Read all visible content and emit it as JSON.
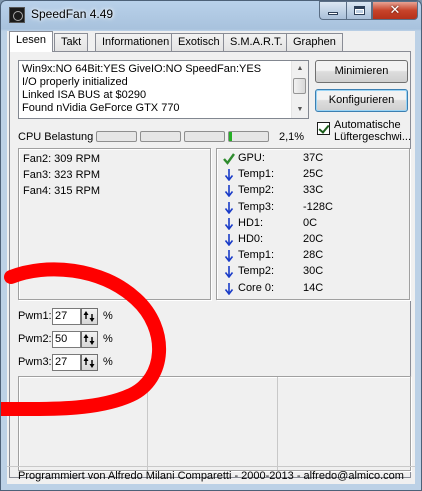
{
  "window": {
    "title": "SpeedFan 4.49",
    "close_glyph": "✕"
  },
  "tabs": [
    {
      "label": "Lesen",
      "active": true
    },
    {
      "label": "Takt"
    },
    {
      "label": "Informationen"
    },
    {
      "label": "Exotisch"
    },
    {
      "label": "S.M.A.R.T."
    },
    {
      "label": "Graphen"
    }
  ],
  "log": {
    "lines": [
      "Win9x:NO  64Bit:YES  GiveIO:NO  SpeedFan:YES",
      "I/O properly initialized",
      "Linked ISA BUS at $0290",
      "Found nVidia GeForce GTX 770"
    ]
  },
  "buttons": {
    "minimize": "Minimieren",
    "configure": "Konfigurieren"
  },
  "auto_fan": {
    "label": "Automatische Lüftergeschwi...",
    "checked": true
  },
  "cpu": {
    "label": "CPU Belastung",
    "value": "2,1%",
    "load_percent": 2.1
  },
  "fans": [
    {
      "text": "Fan2: 309 RPM"
    },
    {
      "text": "Fan3: 323 RPM"
    },
    {
      "text": "Fan4: 315 RPM"
    }
  ],
  "temps": [
    {
      "name": "GPU:",
      "value": "37C",
      "icon": "check-icon"
    },
    {
      "name": "Temp1:",
      "value": "25C",
      "icon": "arrow-down-icon"
    },
    {
      "name": "Temp2:",
      "value": "33C",
      "icon": "arrow-down-icon"
    },
    {
      "name": "Temp3:",
      "value": "-128C",
      "icon": "arrow-down-icon"
    },
    {
      "name": "HD1:",
      "value": "0C",
      "icon": "arrow-down-icon"
    },
    {
      "name": "HD0:",
      "value": "20C",
      "icon": "arrow-down-icon"
    },
    {
      "name": "Temp1:",
      "value": "28C",
      "icon": "arrow-down-icon"
    },
    {
      "name": "Temp2:",
      "value": "30C",
      "icon": "arrow-down-icon"
    },
    {
      "name": "Core 0:",
      "value": "14C",
      "icon": "arrow-down-icon"
    }
  ],
  "pwm": [
    {
      "label": "Pwm1:",
      "value": "27",
      "unit": "%"
    },
    {
      "label": "Pwm2:",
      "value": "50",
      "unit": "%"
    },
    {
      "label": "Pwm3:",
      "value": "27",
      "unit": "%"
    }
  ],
  "status": "Programmiert von Alfredo Milani Comparetti - 2000-2013 - alfredo@almico.com",
  "colors": {
    "check": "#2e8b2e",
    "arrow": "#1a3cc8",
    "annotation": "#ff0000",
    "cpu_fill": "#26b026"
  }
}
